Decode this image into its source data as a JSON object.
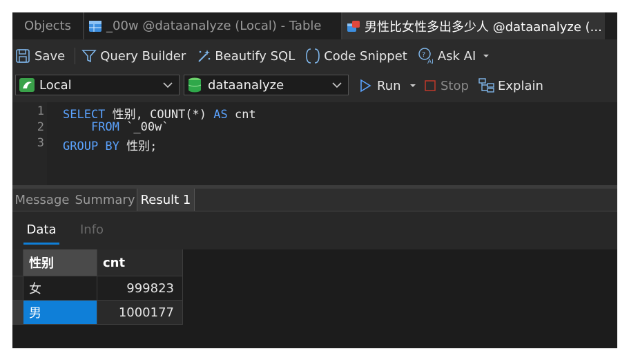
{
  "tabs": [
    {
      "label": "Objects"
    },
    {
      "label": "_00w @dataanalyze (Local) - Table"
    },
    {
      "label": "男性比女性多出多少人 @dataanalyze (..."
    }
  ],
  "toolbar": {
    "save": "Save",
    "query_builder": "Query Builder",
    "beautify_sql": "Beautify SQL",
    "code_snippet": "Code Snippet",
    "ask_ai": "Ask AI"
  },
  "connection": {
    "value": "Local"
  },
  "database": {
    "value": "dataanalyze"
  },
  "actions": {
    "run": "Run",
    "stop": "Stop",
    "explain": "Explain"
  },
  "editor": {
    "lines": [
      {
        "no": "1",
        "kw1": "SELECT",
        "t1": " 性别, COUNT(*) ",
        "kw2": "AS",
        "t2": " cnt"
      },
      {
        "no": "2",
        "indent": "    ",
        "kw1": "FROM",
        "t1": " `_00w`",
        "kw2": "",
        "t2": ""
      },
      {
        "no": "3",
        "kw1": "GROUP BY",
        "t1": " 性别;",
        "kw2": "",
        "t2": ""
      }
    ]
  },
  "result_tabs": [
    {
      "label": "Message"
    },
    {
      "label": "Summary"
    },
    {
      "label": "Result 1"
    }
  ],
  "sub_tabs": [
    {
      "label": "Data"
    },
    {
      "label": "Info"
    }
  ],
  "grid": {
    "columns": [
      "性别",
      "cnt"
    ],
    "rows": [
      {
        "gender": "女",
        "cnt": "999823"
      },
      {
        "gender": "男",
        "cnt": "1000177"
      }
    ]
  },
  "colors": {
    "accent": "#0f7fd8",
    "keyword": "#5ba3ff",
    "background": "#2b2b2b"
  }
}
